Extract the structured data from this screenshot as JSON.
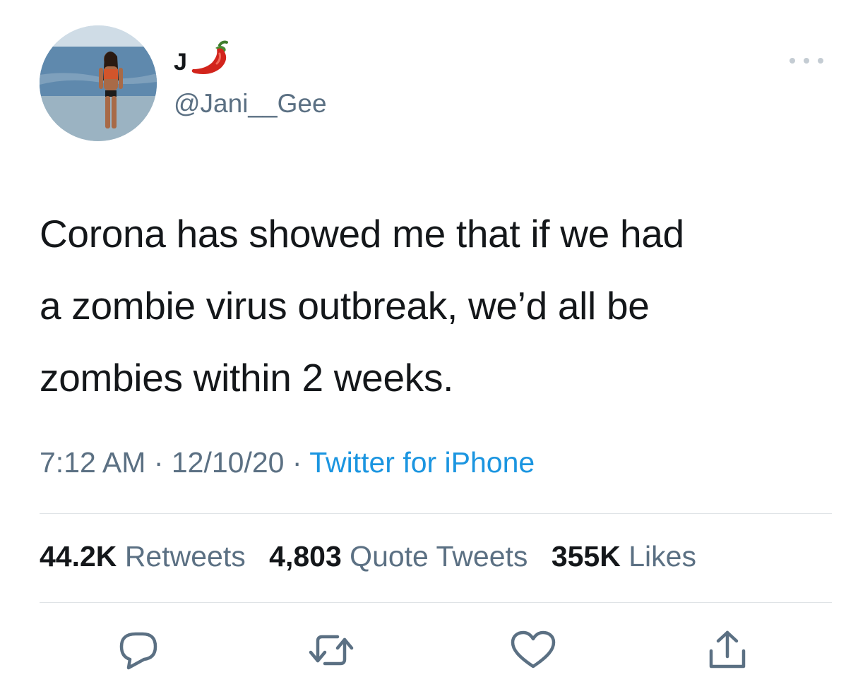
{
  "author": {
    "display_name": "J",
    "name_emoji": "hot-pepper-icon",
    "handle": "@Jani__Gee"
  },
  "tweet": {
    "text_lines": [
      "Corona has showed me that if we had",
      "a zombie virus outbreak, we’d all be",
      "zombies within 2 weeks."
    ]
  },
  "meta": {
    "time": "7:12 AM",
    "sep1": " · ",
    "date": "12/10/20",
    "sep2": " · ",
    "source": "Twitter for iPhone"
  },
  "stats": {
    "retweets_count": "44.2K",
    "retweets_label": "Retweets",
    "quotes_count": "4,803",
    "quotes_label": "Quote Tweets",
    "likes_count": "355K",
    "likes_label": "Likes"
  },
  "actions": {
    "reply": "reply-icon",
    "retweet": "retweet-icon",
    "like": "heart-icon",
    "share": "share-icon"
  },
  "colors": {
    "text": "#14171a",
    "secondary": "#5b7083",
    "link": "#1b95e0",
    "divider": "#dfe3e6"
  }
}
